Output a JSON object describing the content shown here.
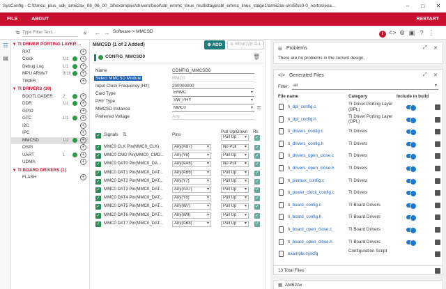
{
  "window": {
    "title": "SysConfig - C:\\ti\\mcu_plus_sdk_am62ax_08_06_00_18\\examples\\drivers\\boot\\sbl_emmc_linux_multistage\\sbl_emmc_linux_stage1\\am62ax-sk\\r5fss0-0_nortos\\example.syscfg"
  },
  "menu": {
    "file": "FILE",
    "about": "ABOUT",
    "restart": "RESTART"
  },
  "sidebar": {
    "filter_placeholder": "Type Filter Text...",
    "groups": [
      {
        "label": "TI DRIVER PORTING LAYER ...",
        "items": [
          {
            "label": "RAT",
            "count": "",
            "ok": false
          },
          {
            "label": "Clock",
            "count": "1/1",
            "ok": true
          },
          {
            "label": "Debug Log",
            "count": "1/1",
            "ok": true
          },
          {
            "label": "MPU ARMv7",
            "count": "9/16",
            "ok": true
          },
          {
            "label": "TIMER",
            "count": "",
            "ok": false
          }
        ]
      },
      {
        "label": "TI DRIVERS (10)",
        "items": [
          {
            "label": "BOOTLOADER",
            "count": "2",
            "ok": true
          },
          {
            "label": "DDR",
            "count": "1/1",
            "ok": true
          },
          {
            "label": "GPIO",
            "count": "",
            "ok": false
          },
          {
            "label": "GTC",
            "count": "1/1",
            "ok": true
          },
          {
            "label": "I2C",
            "count": "",
            "ok": false
          },
          {
            "label": "IPC",
            "count": "",
            "ok": false
          },
          {
            "label": "MMCSD",
            "count": "1/2",
            "ok": true
          },
          {
            "label": "OSPI",
            "count": "",
            "ok": false
          },
          {
            "label": "UART",
            "count": "1",
            "ok": true
          },
          {
            "label": "UDMA",
            "count": "",
            "ok": false
          }
        ]
      },
      {
        "label": "TI BOARD DRIVERS (1)",
        "items": [
          {
            "label": "FLASH",
            "count": "",
            "ok": false
          }
        ]
      }
    ]
  },
  "breadcrumb": {
    "software": "Software",
    "sep": ">",
    "current": "MMCSD"
  },
  "module": {
    "header": "MMCSD (1 of 2 Added)",
    "add_label": "ADD",
    "remove_all_label": "REMOVE ALL",
    "instance_name": "CONFIG_MMCSD0",
    "fields": [
      {
        "label": "Name",
        "value": "CONFIG_MMCSD0",
        "kind": "text"
      },
      {
        "label": "Select MMCSD Module",
        "value": "MMC0",
        "kind": "disabled"
      },
      {
        "label": "Input Clock Frequency (Hz)",
        "value": "200000000",
        "kind": "text"
      },
      {
        "label": "Card Type",
        "value": "EMMC",
        "kind": "select"
      },
      {
        "label": "PHY Type",
        "value": "SW_PHY",
        "kind": "select"
      },
      {
        "label": "MMCSD Instance",
        "value": "MMC0",
        "kind": "select"
      },
      {
        "label": "Preferred Voltage",
        "value": "Any",
        "kind": "disabled"
      }
    ],
    "signals_header": {
      "signals": "Signals",
      "pins": "Pins",
      "pull": "Pull Up/Down",
      "rx": "Rx"
    },
    "signals_top_pull": "Pull Up",
    "signals": [
      {
        "name": "MMC0 CLK Pin(MMC0_CLK)",
        "pin": "Any(AB7)",
        "pull": "No Pull",
        "rx": true
      },
      {
        "name": "MMC0 CMD Pin(MMC0_CMD...",
        "pin": "Any(Y6)",
        "pull": "Pull Up",
        "rx": true
      },
      {
        "name": "MMC0 DAT0 Pin(MMC0_DA...",
        "pin": "Any(AA6)",
        "pull": "No Pull",
        "rx": true
      },
      {
        "name": "MMC0 DAT1 Pin(MMC0_DAT...",
        "pin": "Any(AB6)",
        "pull": "Pull Up",
        "rx": true
      },
      {
        "name": "MMC0 DAT2 Pin(MMC0_DAT...",
        "pin": "Any(Y7)",
        "pull": "Pull Up",
        "rx": true
      },
      {
        "name": "MMC0 DAT3 Pin(MMC0_DAT...",
        "pin": "Any(AA7)",
        "pull": "Pull Up",
        "rx": true
      },
      {
        "name": "MMC0 DAT4 Pin(MMC0_DAT...",
        "pin": "Any(Y8)",
        "pull": "Pull Up",
        "rx": true
      },
      {
        "name": "MMC0 DAT5 Pin(MMC0_DAT...",
        "pin": "Any(W7)",
        "pull": "Pull Up",
        "rx": true
      },
      {
        "name": "MMC0 DAT6 Pin(MMC0_DAT...",
        "pin": "Any(W9)",
        "pull": "Pull Up",
        "rx": true
      },
      {
        "name": "MMC0 DAT7 Pin(MMC0_DAT...",
        "pin": "Any(AB8)",
        "pull": "Pull Up",
        "rx": true
      }
    ]
  },
  "problems": {
    "title": "Problems",
    "message": "There are no problems in the current design."
  },
  "generated": {
    "title": "Generated Files",
    "filter_label": "Filter:",
    "filter_value": "all",
    "columns": {
      "file": "File name",
      "category": "Category",
      "include": "Include in build"
    },
    "files": [
      {
        "name": "ti_dpl_config.c",
        "category": "TI Driver Porting Layer (DPL)",
        "toggle": true
      },
      {
        "name": "ti_dpl_config.h",
        "category": "TI Driver Porting Layer (DPL)",
        "toggle": true
      },
      {
        "name": "ti_drivers_config.c",
        "category": "TI Drivers",
        "toggle": true
      },
      {
        "name": "ti_drivers_config.h",
        "category": "TI Drivers",
        "toggle": true
      },
      {
        "name": "ti_drivers_open_close.c",
        "category": "TI Drivers",
        "toggle": true
      },
      {
        "name": "ti_drivers_open_close.h",
        "category": "TI Drivers",
        "toggle": true
      },
      {
        "name": "ti_pinmux_config.c",
        "category": "TI Drivers",
        "toggle": true
      },
      {
        "name": "ti_power_clock_config.c",
        "category": "TI Drivers",
        "toggle": true
      },
      {
        "name": "ti_board_config.c",
        "category": "TI Board Drivers",
        "toggle": true
      },
      {
        "name": "ti_board_config.h",
        "category": "TI Board Drivers",
        "toggle": true
      },
      {
        "name": "ti_board_open_close.c",
        "category": "TI Board Drivers",
        "toggle": true
      },
      {
        "name": "ti_board_open_close.h",
        "category": "TI Board Drivers",
        "toggle": true
      },
      {
        "name": "example.syscfg",
        "category": "Configuration Script",
        "toggle": false
      }
    ],
    "total": "13 Total Files"
  },
  "device": {
    "title": "AM62Ax"
  },
  "colors": {
    "brand_red": "#c8102e",
    "teal": "#1f7a7a",
    "green": "#2e9a47",
    "blue": "#1a7ad4"
  }
}
